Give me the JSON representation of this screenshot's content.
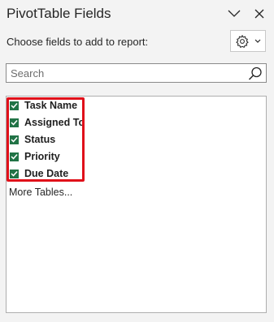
{
  "panel": {
    "title": "PivotTable Fields",
    "subtitle": "Choose fields to add to report:"
  },
  "header_icons": [
    "chevron-down-icon",
    "close-icon"
  ],
  "settings": {
    "icon": "gear-icon",
    "dropdown_icon": "chevron-down-icon"
  },
  "search": {
    "placeholder": "Search",
    "value": "",
    "icon": "search-icon"
  },
  "fields": [
    {
      "label": "Task Name",
      "checked": true
    },
    {
      "label": "Assigned To",
      "checked": true
    },
    {
      "label": "Status",
      "checked": true
    },
    {
      "label": "Priority",
      "checked": true
    },
    {
      "label": "Due Date",
      "checked": true
    }
  ],
  "more_tables": "More Tables...",
  "colors": {
    "checkbox": "#217346",
    "highlight": "#e0101a",
    "panel_bg": "#f3f3f3"
  }
}
